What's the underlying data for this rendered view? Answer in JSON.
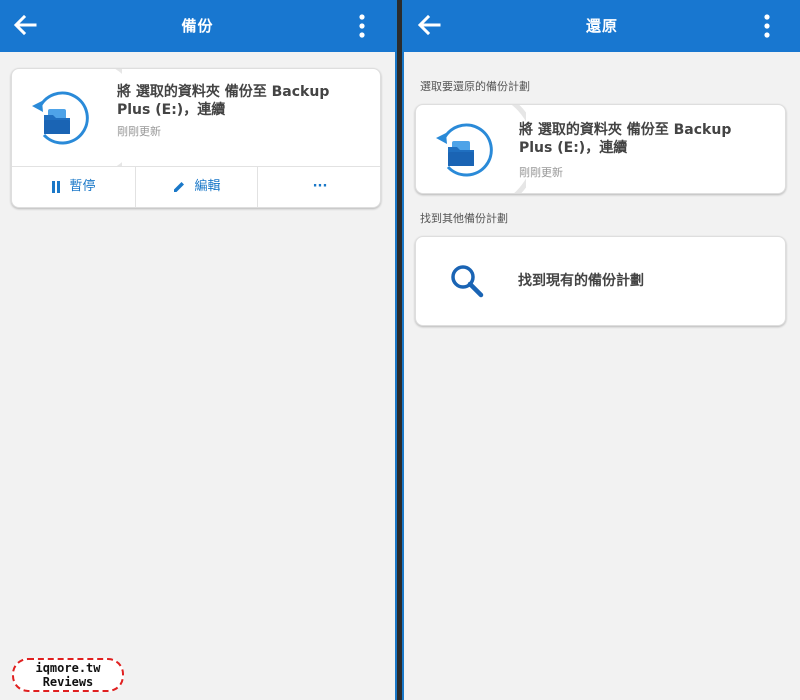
{
  "left": {
    "title": "備份",
    "plan": {
      "name": "將 選取的資料夾 備份至 Backup Plus (E:)，連續",
      "status": "剛剛更新"
    },
    "actions": {
      "pause": "暫停",
      "edit": "編輯",
      "more": "···"
    }
  },
  "right": {
    "title": "還原",
    "section_selected": "選取要還原的備份計劃",
    "plan": {
      "name": "將 選取的資料夾 備份至 Backup Plus (E:)，連續",
      "status": "剛剛更新"
    },
    "section_other": "找到其他備份計劃",
    "find_label": "找到現有的備份計劃"
  },
  "watermark": {
    "line1": "iqmore.tw",
    "line2": "Reviews"
  },
  "colors": {
    "accent": "#1877d0",
    "card": "#ffffff",
    "background": "#f2f2f2"
  }
}
